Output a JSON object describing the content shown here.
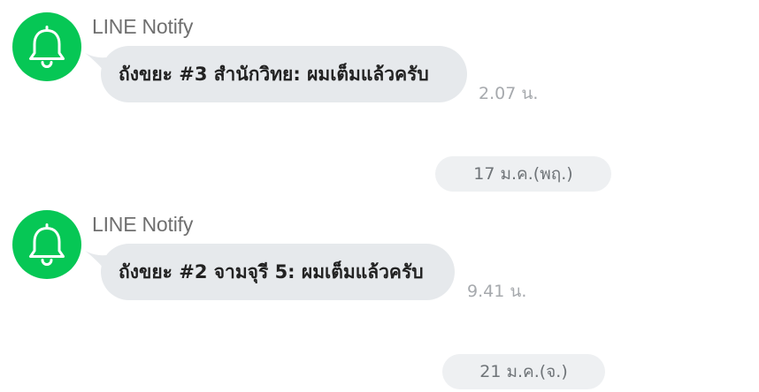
{
  "messages": [
    {
      "sender": "LINE Notify",
      "text": "ถังขยะ #3 สำนักวิทย: ผมเต็มแล้วครับ",
      "time": "2.07 น.",
      "avatar_icon": "bell-icon"
    },
    {
      "sender": "LINE Notify",
      "text": "ถังขยะ #2 จามจุรี 5: ผมเต็มแล้วครับ",
      "time": "9.41 น.",
      "avatar_icon": "bell-icon"
    }
  ],
  "dates": [
    "17 ม.ค.(พฤ.)",
    "21 ม.ค.(จ.)"
  ],
  "colors": {
    "avatar": "#06c755",
    "bubble": "#e6e9ec",
    "date_pill": "#eef0f2",
    "sender_text": "#6f6f6f",
    "time_text": "#a6a9ad"
  }
}
